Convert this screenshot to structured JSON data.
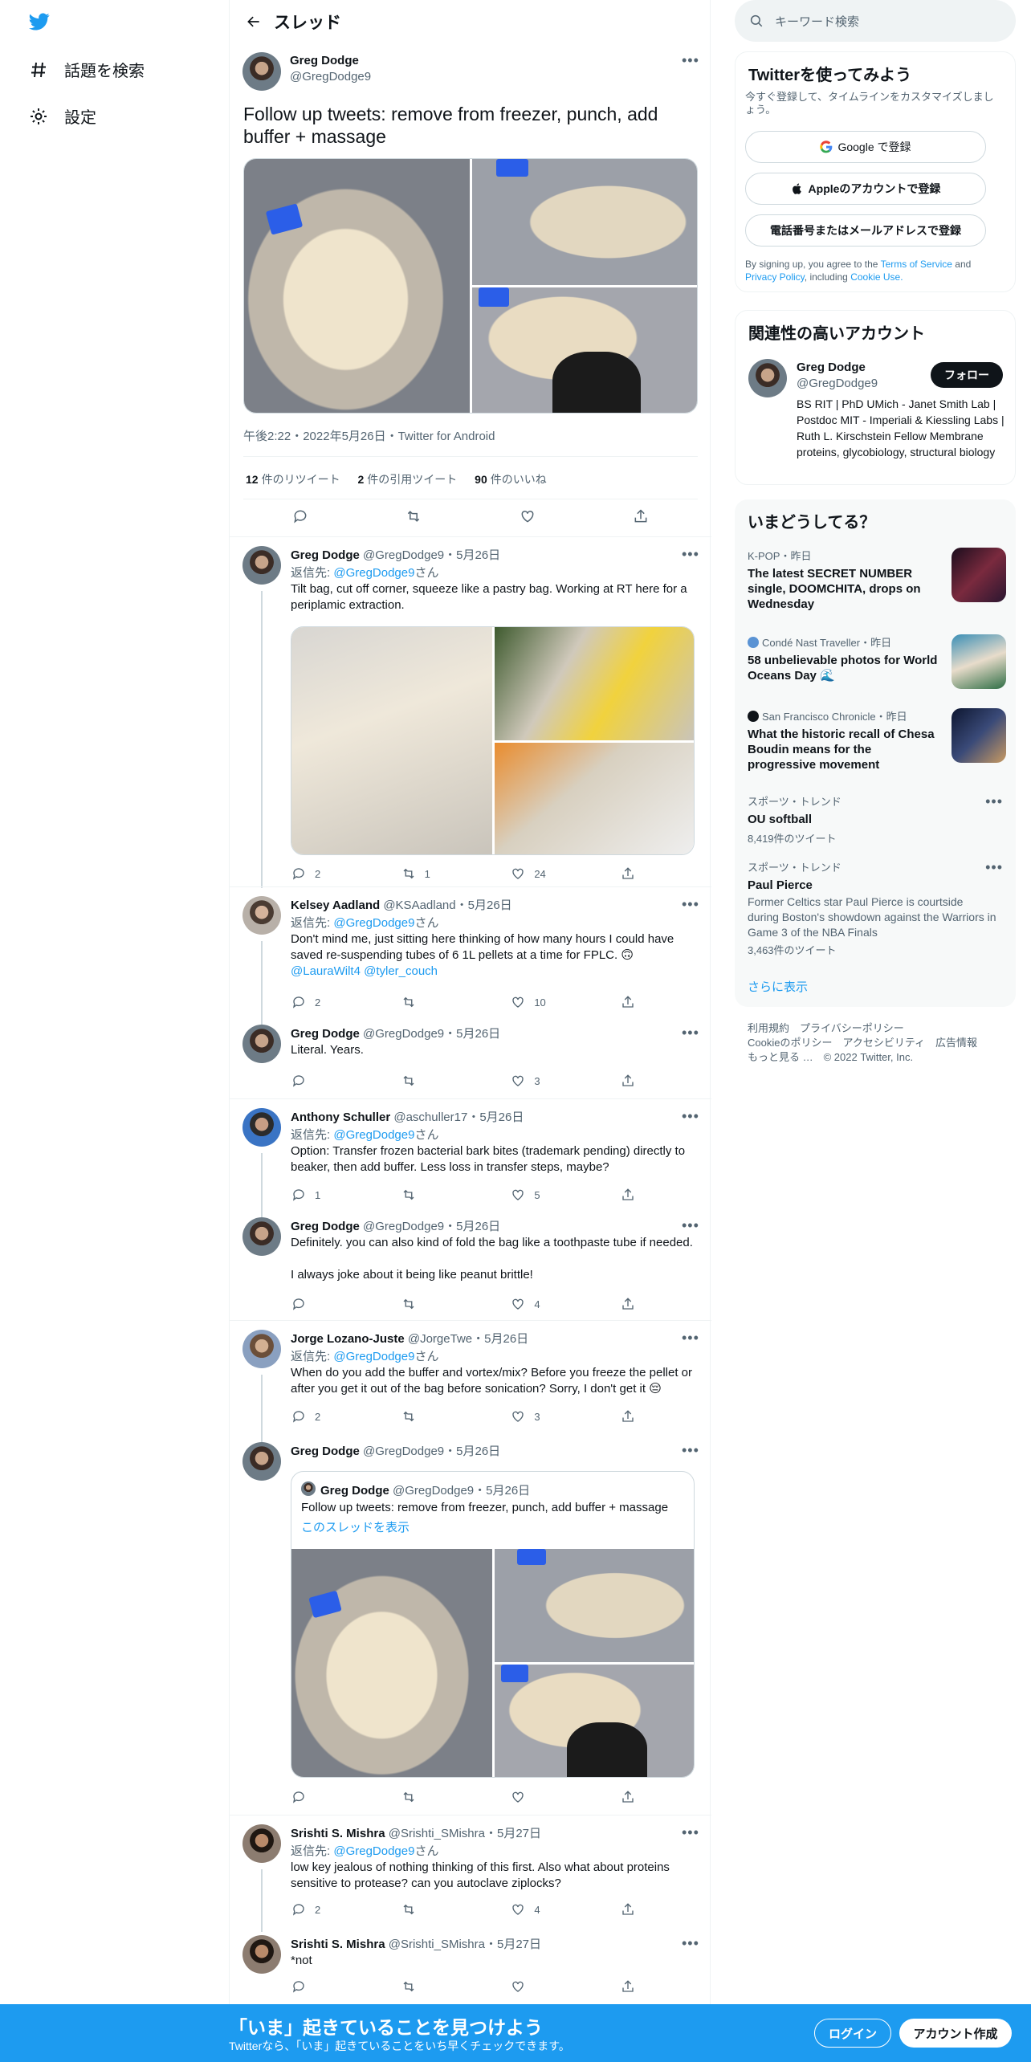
{
  "nav": {
    "explore_label": "話題を検索",
    "settings_label": "設定"
  },
  "header": {
    "title": "スレッド"
  },
  "main_tweet": {
    "name": "Greg Dodge",
    "handle": "@GregDodge9",
    "text": "Follow up tweets: remove from freezer, punch, add buffer + massage",
    "meta": "午後2:22・2022年5月26日・Twitter for Android",
    "retweets_count": "12",
    "retweets_label": "件のリツイート",
    "quotes_count": "2",
    "quotes_label": "件の引用ツイート",
    "likes_count": "90",
    "likes_label": "件のいいね"
  },
  "replies": [
    {
      "name": "Greg Dodge",
      "handle": "@GregDodge9",
      "date": "5月26日",
      "reply_prefix": "返信先:",
      "reply_to": "@GregDodge9",
      "reply_suffix": "さん",
      "text": "Tilt bag, cut off corner, squeeze like a pastry bag. Working at RT here for a periplamic extraction.",
      "replies": "2",
      "retweets": "1",
      "likes": "24"
    },
    {
      "name": "Kelsey Aadland",
      "handle": "@KSAadland",
      "date": "5月26日",
      "reply_prefix": "返信先:",
      "reply_to": "@GregDodge9",
      "reply_suffix": "さん",
      "text": "Don't mind me, just sitting here thinking of how many hours I could have saved re-suspending tubes of 6 1L pellets at a time for FPLC. 🙃",
      "mentions": "@LauraWilt4 @tyler_couch",
      "replies": "2",
      "retweets": "",
      "likes": "10"
    },
    {
      "name": "Greg Dodge",
      "handle": "@GregDodge9",
      "date": "5月26日",
      "text": "Literal. Years.",
      "replies": "",
      "retweets": "",
      "likes": "3"
    },
    {
      "name": "Anthony Schuller",
      "handle": "@aschuller17",
      "date": "5月26日",
      "reply_prefix": "返信先:",
      "reply_to": "@GregDodge9",
      "reply_suffix": "さん",
      "text": "Option: Transfer frozen bacterial bark bites (trademark pending) directly to beaker, then add buffer. Less loss in transfer steps, maybe?",
      "replies": "1",
      "retweets": "",
      "likes": "5"
    },
    {
      "name": "Greg Dodge",
      "handle": "@GregDodge9",
      "date": "5月26日",
      "text": "Definitely. you can also kind of fold the bag like a toothpaste tube if needed.",
      "text2": "I always joke about it being like peanut brittle!",
      "replies": "",
      "retweets": "",
      "likes": "4"
    },
    {
      "name": "Jorge Lozano-Juste",
      "handle": "@JorgeTwe",
      "date": "5月26日",
      "reply_prefix": "返信先:",
      "reply_to": "@GregDodge9",
      "reply_suffix": "さん",
      "text": "When do you add the buffer and vortex/mix? Before you freeze the pellet or after you get it out of the bag before sonication? Sorry, I don't get it 😔",
      "replies": "2",
      "retweets": "",
      "likes": "3"
    },
    {
      "name": "Greg Dodge",
      "handle": "@GregDodge9",
      "date": "5月26日",
      "quote_name": "Greg Dodge",
      "quote_handle": "@GregDodge9",
      "quote_date": "5月26日",
      "quote_text": "Follow up tweets: remove from freezer, punch, add buffer + massage",
      "quote_link": "このスレッドを表示",
      "replies": "",
      "retweets": "",
      "likes": ""
    },
    {
      "name": "Srishti S. Mishra",
      "handle": "@Srishti_SMishra",
      "date": "5月27日",
      "reply_prefix": "返信先:",
      "reply_to": "@GregDodge9",
      "reply_suffix": "さん",
      "text": "low key jealous of nothing thinking of this first. Also what about proteins sensitive to protease? can you autoclave ziplocks?",
      "replies": "2",
      "retweets": "",
      "likes": "4"
    },
    {
      "name": "Srishti S. Mishra",
      "handle": "@Srishti_SMishra",
      "date": "5月27日",
      "text": "*not",
      "replies": "",
      "retweets": "",
      "likes": ""
    }
  ],
  "search": {
    "placeholder": "キーワード検索"
  },
  "signup": {
    "title": "Twitterを使ってみよう",
    "subtitle": "今すぐ登録して、タイムラインをカスタマイズしましょう。",
    "google": "Google で登録",
    "apple": "Appleのアカウントで登録",
    "phone": "電話番号またはメールアドレスで登録",
    "terms_pre": "By signing up, you agree to the",
    "terms_link": "Terms of Service",
    "terms_and": "and",
    "privacy_link": "Privacy Policy",
    "terms_including": ", including",
    "cookie_link": "Cookie Use."
  },
  "relevant": {
    "title": "関連性の高いアカウント",
    "name": "Greg Dodge",
    "handle": "@GregDodge9",
    "follow": "フォロー",
    "bio": "BS RIT | PhD UMich - Janet Smith Lab | Postdoc MIT - Imperiali & Kiessling Labs | Ruth L. Kirschstein Fellow Membrane proteins, glycobiology, structural biology"
  },
  "trends": {
    "title": "いまどうしてる？",
    "items": [
      {
        "category": "K-POP・昨日",
        "title": "The latest SECRET NUMBER single, DOOMCHITA, drops on Wednesday"
      },
      {
        "category": "Condé Nast Traveller・昨日",
        "title": "58 unbelievable photos for World Oceans Day 🌊"
      },
      {
        "category": "San Francisco Chronicle・昨日",
        "title": "What the historic recall of Chesa Boudin means for the progressive movement"
      },
      {
        "category": "スポーツ・トレンド",
        "title": "OU softball",
        "count": "8,419件のツイート"
      },
      {
        "category": "スポーツ・トレンド",
        "title": "Paul Pierce",
        "desc": "Former Celtics star Paul Pierce is courtside during Boston's showdown against the Warriors in Game 3 of the NBA Finals",
        "count": "3,463件のツイート"
      }
    ],
    "more": "さらに表示"
  },
  "footer": {
    "line1": "利用規約　プライバシーポリシー",
    "line2": "Cookieのポリシー　アクセシビリティ　広告情報",
    "line3": "もっと見る …　© 2022 Twitter, Inc."
  },
  "banner": {
    "title": "「いま」起きていることを見つけよう",
    "subtitle": "Twitterなら、「いま」起きていることをいち早くチェックできます。",
    "login": "ログイン",
    "signup": "アカウント作成"
  }
}
